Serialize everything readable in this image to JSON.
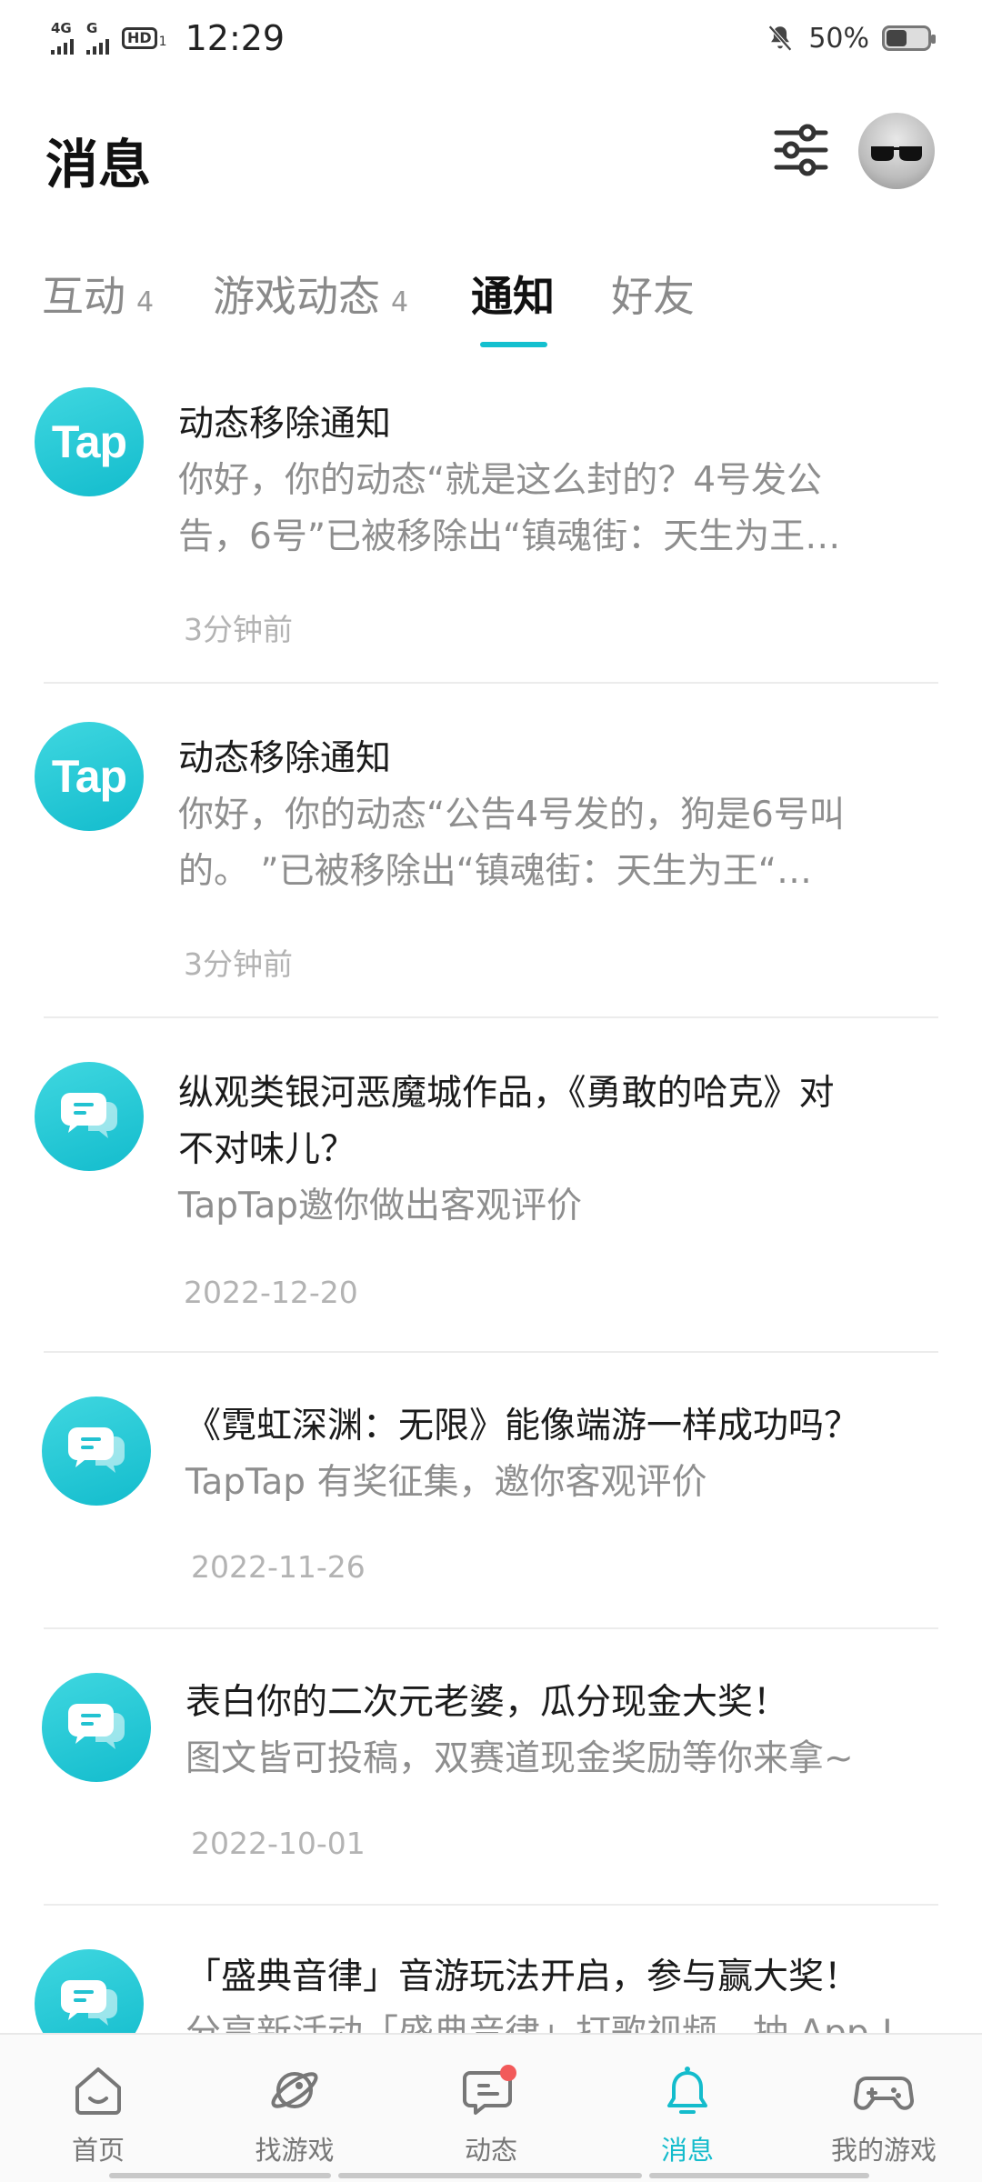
{
  "status_bar": {
    "network_1": "4G",
    "network_2": "G",
    "hd": "HD",
    "hd_sub": "1",
    "time": "12:29",
    "battery": "50%"
  },
  "header": {
    "title": "消息"
  },
  "tabs": [
    {
      "label": "互动",
      "count": "4"
    },
    {
      "label": "游戏动态",
      "count": "4"
    },
    {
      "label": "通知",
      "count": ""
    },
    {
      "label": "好友",
      "count": ""
    }
  ],
  "active_tab": "通知",
  "messages": [
    {
      "icon": "Tap",
      "title": "动态移除通知",
      "body_lines": [
        "你好，你的动态“就是这么封的？4号发公",
        "告，6号”已被移除出“镇魂街：天生为王…"
      ],
      "time": "3分钟前"
    },
    {
      "icon": "Tap",
      "title": "动态移除通知",
      "body_lines": [
        "你好，你的动态“公告4号发的，狗是6号叫",
        "的。 ”已被移除出“镇魂街：天生为王“…"
      ],
      "time": "3分钟前"
    },
    {
      "icon": "chat-bubble",
      "title_lines": [
        "纵观类银河恶魔城作品，《勇敢的哈克》对",
        "不对味儿？"
      ],
      "body": "TapTap邀你做出客观评价",
      "time": "2022-12-20"
    },
    {
      "icon": "chat-bubble",
      "title": "《霓虹深渊：无限》能像端游一样成功吗？",
      "body": "TapTap  有奖征集，邀你客观评价",
      "time": "2022-11-26"
    },
    {
      "icon": "chat-bubble",
      "title": "表白你的二次元老婆，瓜分现金大奖！",
      "body": "图文皆可投稿，双赛道现金奖励等你来拿~",
      "time": "2022-10-01"
    },
    {
      "icon": "chat-bubble",
      "title": "「盛典音律」音游玩法开启，参与赢大奖！",
      "body": "分享新活动「盛典音律」打歌视频，抽 App !"
    }
  ],
  "bottom_nav": [
    {
      "label": "首页",
      "icon": "home-icon"
    },
    {
      "label": "找游戏",
      "icon": "planet-icon"
    },
    {
      "label": "动态",
      "icon": "feed-icon",
      "badge": true
    },
    {
      "label": "消息",
      "icon": "bell-icon",
      "active": true
    },
    {
      "label": "我的游戏",
      "icon": "gamepad-icon"
    }
  ],
  "colors": {
    "accent": "#14bccc",
    "badge": "#f25a5a"
  }
}
